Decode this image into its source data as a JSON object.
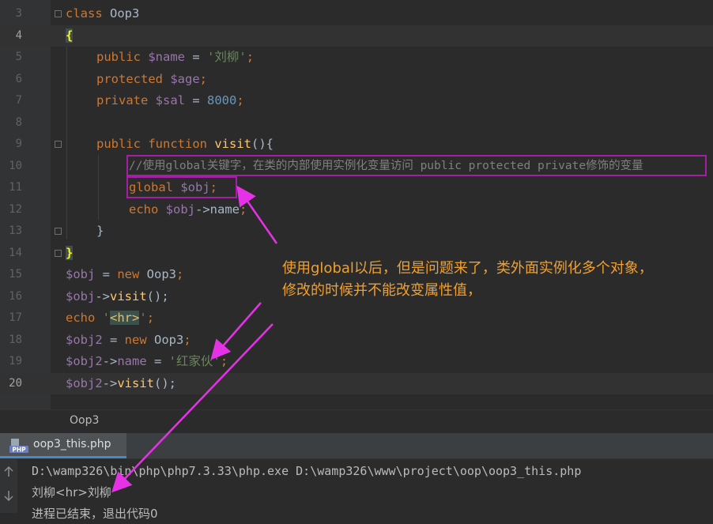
{
  "editor": {
    "lines": [
      {
        "num": "3"
      },
      {
        "num": "4"
      },
      {
        "num": "5"
      },
      {
        "num": "6"
      },
      {
        "num": "7"
      },
      {
        "num": "8"
      },
      {
        "num": "9"
      },
      {
        "num": "10"
      },
      {
        "num": "11"
      },
      {
        "num": "12"
      },
      {
        "num": "13"
      },
      {
        "num": "14"
      },
      {
        "num": "15"
      },
      {
        "num": "16"
      },
      {
        "num": "17"
      },
      {
        "num": "18"
      },
      {
        "num": "19"
      },
      {
        "num": "20"
      }
    ],
    "tokens": {
      "class_kw": "class",
      "class_name": " Oop3",
      "open_brace": "{",
      "public_kw": "public",
      "name_var": "$name",
      "eq": " = ",
      "name_str": "'刘柳'",
      "semi": ";",
      "protected_kw": "protected",
      "age_var": "$age",
      "private_kw": "private",
      "sal_var": "$sal",
      "sal_num": "8000",
      "function_kw": "function",
      "visit_fn": "visit",
      "parens_open": "(){",
      "comment": "//使用global关键字，在类的内部使用实例化变量访问 public protected private修饰的变量",
      "global_kw": "global",
      "obj_var": "$obj",
      "echo_kw": "echo",
      "arrow_name": "->name",
      "close_brace": "}",
      "new_kw": "new",
      "oop3": " Oop3",
      "arrow": "->",
      "call": "();",
      "hr_q1": "'",
      "hr_tag": "<hr>",
      "hr_q2": "'",
      "obj2_var": "$obj2",
      "name_prop": "name",
      "str_red": "'红家伙'"
    },
    "colors": {
      "background": "#2b2b2b",
      "keyword": "#cc7832",
      "variable": "#9876aa",
      "string": "#6a8759",
      "number": "#6897bb",
      "function": "#ffc66d",
      "comment": "#808080",
      "highlight_box": "#a31fa3",
      "annotation": "#f0a030",
      "arrow": "#e632e6"
    }
  },
  "breadcrumb": {
    "text": "Oop3"
  },
  "run_panel": {
    "tab_label": "oop3_this.php",
    "tab_icon": "php-file-icon",
    "console_lines": [
      "D:\\wamp326\\bin\\php\\php7.3.33\\php.exe D:\\wamp326\\www\\project\\oop\\oop3_this.php",
      "刘柳<hr>刘柳",
      "进程已结束，退出代码0"
    ]
  },
  "annotation": {
    "line1": "使用global以后，但是问题来了，类外面实例化多个对象，",
    "line2": "修改的时候并不能改变属性值，"
  }
}
